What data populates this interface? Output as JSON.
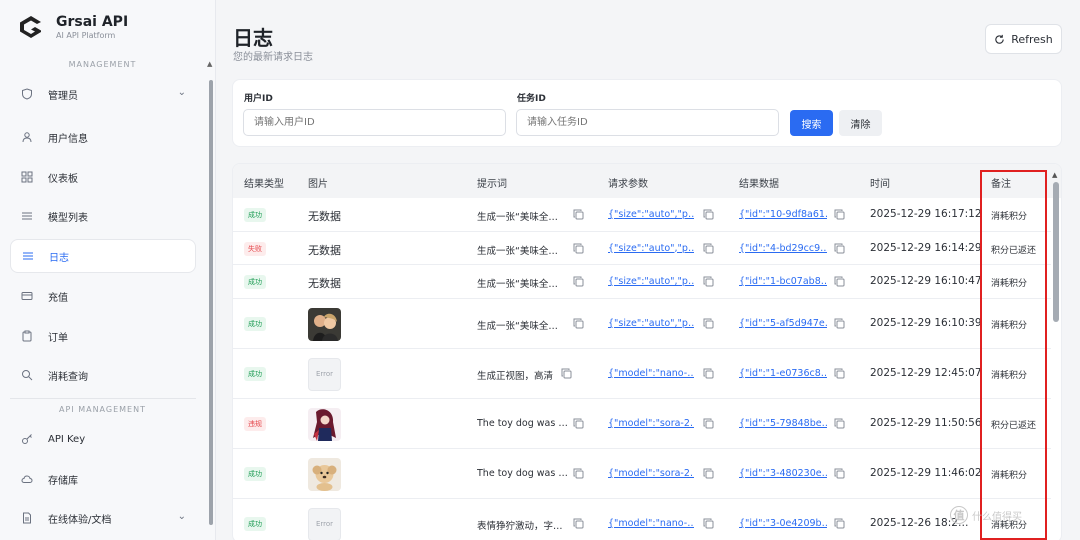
{
  "brand": {
    "name": "Grsai API",
    "subtitle": "AI API Platform"
  },
  "sidebar": {
    "section_management": "MANAGEMENT",
    "section_api": "API MANAGEMENT",
    "items": [
      {
        "label": "管理员",
        "icon": "shield-icon"
      },
      {
        "label": "用户信息",
        "icon": "user-icon"
      },
      {
        "label": "仪表板",
        "icon": "dashboard-icon"
      },
      {
        "label": "模型列表",
        "icon": "list-icon"
      },
      {
        "label": "日志",
        "icon": "log-icon"
      },
      {
        "label": "充值",
        "icon": "wallet-icon"
      },
      {
        "label": "订单",
        "icon": "clipboard-icon"
      },
      {
        "label": "消耗查询",
        "icon": "search-icon"
      },
      {
        "label": "API Key",
        "icon": "key-icon"
      },
      {
        "label": "存储库",
        "icon": "cloud-icon"
      },
      {
        "label": "在线体验/文档",
        "icon": "document-icon"
      }
    ]
  },
  "header": {
    "title": "日志",
    "subtitle": "您的最新请求日志",
    "refresh_label": "Refresh"
  },
  "filters": {
    "user_label": "用户ID",
    "user_placeholder": "请输入用户ID",
    "task_label": "任务ID",
    "task_placeholder": "请输入任务ID",
    "search_label": "搜索",
    "clear_label": "清除"
  },
  "table": {
    "columns": [
      "结果类型",
      "图片",
      "提示词",
      "请求参数",
      "结果数据",
      "时间",
      "备注"
    ],
    "rows": [
      {
        "status": "成功",
        "status_type": "ok",
        "image": "无数据",
        "prompt": "生成一张“美味全…",
        "params": "{\"size\":\"auto\",\"p…",
        "result": "{\"id\":\"10-9df8a61…",
        "time": "2025-12-29 16:17:12",
        "note": "消耗积分"
      },
      {
        "status": "失败",
        "status_type": "fail",
        "image": "无数据",
        "prompt": "生成一张“美味全…",
        "params": "{\"size\":\"auto\",\"p…",
        "result": "{\"id\":\"4-bd29cc9…",
        "time": "2025-12-29 16:14:29",
        "note": "积分已返还"
      },
      {
        "status": "成功",
        "status_type": "ok",
        "image": "无数据",
        "prompt": "生成一张“美味全…",
        "params": "{\"size\":\"auto\",\"p…",
        "result": "{\"id\":\"1-bc07ab8…",
        "time": "2025-12-29 16:10:47",
        "note": "消耗积分"
      },
      {
        "status": "成功",
        "status_type": "ok",
        "image": "photo",
        "prompt": "生成一张“美味全…",
        "params": "{\"size\":\"auto\",\"p…",
        "result": "{\"id\":\"5-af5d947e…",
        "time": "2025-12-29 16:10:39",
        "note": "消耗积分"
      },
      {
        "status": "成功",
        "status_type": "ok",
        "image": "Error",
        "prompt": "生成正视图，高清",
        "params": "{\"model\":\"nano-…",
        "result": "{\"id\":\"1-e0736c8…",
        "time": "2025-12-29 12:45:07",
        "note": "消耗积分"
      },
      {
        "status": "违规",
        "status_type": "fail",
        "image": "anime",
        "prompt": "The toy dog was …",
        "params": "{\"model\":\"sora-2…",
        "result": "{\"id\":\"5-79848be…",
        "time": "2025-12-29 11:50:56",
        "note": "积分已返还"
      },
      {
        "status": "成功",
        "status_type": "ok",
        "image": "dog",
        "prompt": "The toy dog was …",
        "params": "{\"model\":\"sora-2…",
        "result": "{\"id\":\"3-480230e…",
        "time": "2025-12-29 11:46:02",
        "note": "消耗积分"
      },
      {
        "status": "成功",
        "status_type": "ok",
        "image": "Error",
        "prompt": "表情狰狞激动，字…",
        "params": "{\"model\":\"nano-…",
        "result": "{\"id\":\"3-0e4209b…",
        "time": "2025-12-26 18:2…",
        "note": "消耗积分"
      }
    ]
  },
  "watermark": {
    "text": "什么值得买",
    "mark": "值"
  },
  "colors": {
    "accent": "#2a6bf2",
    "success": "#1f9d55",
    "danger": "#e5484d",
    "highlight_box": "#e02020"
  }
}
